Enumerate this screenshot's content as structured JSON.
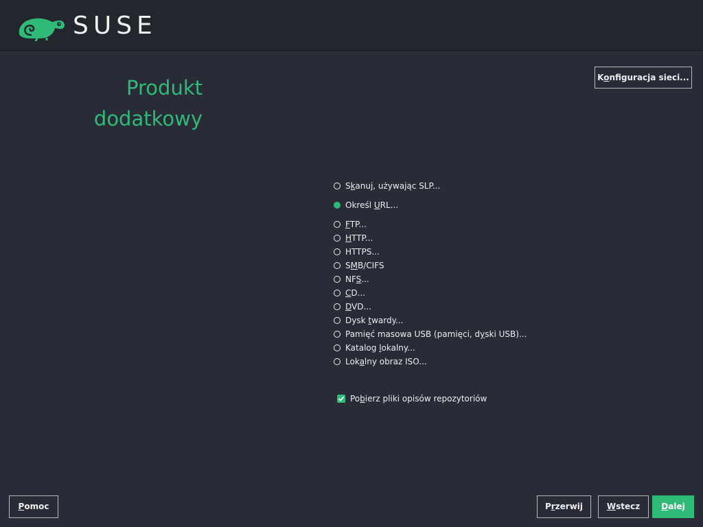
{
  "header": {
    "brand": "SUSE",
    "logo_icon": "suse-chameleon-logo"
  },
  "title": {
    "line1": "Produkt",
    "line2": "dodatkowy"
  },
  "network_button": {
    "pre": "K",
    "ul": "o",
    "post": "nfiguracja sieci..."
  },
  "radio_options": [
    {
      "pre": "S",
      "ul": "k",
      "post": "anuj, używając SLP...",
      "selected": false
    },
    {
      "pre": "Określ ",
      "ul": "U",
      "post": "RL...",
      "selected": true
    },
    {
      "pre": "",
      "ul": "F",
      "post": "TP...",
      "selected": false
    },
    {
      "pre": "",
      "ul": "H",
      "post": "TTP...",
      "selected": false
    },
    {
      "pre": "HTTPS...",
      "ul": "",
      "post": "",
      "selected": false
    },
    {
      "pre": "S",
      "ul": "M",
      "post": "B/CIFS",
      "selected": false
    },
    {
      "pre": "NF",
      "ul": "S",
      "post": "...",
      "selected": false
    },
    {
      "pre": "",
      "ul": "C",
      "post": "D...",
      "selected": false
    },
    {
      "pre": "",
      "ul": "D",
      "post": "VD...",
      "selected": false
    },
    {
      "pre": "Dysk ",
      "ul": "t",
      "post": "wardy...",
      "selected": false
    },
    {
      "pre": "Pamięć masowa USB (pamięci, d",
      "ul": "y",
      "post": "ski USB)...",
      "selected": false
    },
    {
      "pre": "Katalog ",
      "ul": "l",
      "post": "okalny...",
      "selected": false
    },
    {
      "pre": "Lok",
      "ul": "a",
      "post": "lny obraz ISO...",
      "selected": false
    }
  ],
  "checkbox": {
    "pre": "Po",
    "ul": "b",
    "post": "ierz pliki opisów repozytoriów",
    "checked": true
  },
  "footer": {
    "help": {
      "pre": "",
      "ul": "P",
      "post": "omoc"
    },
    "abort": {
      "pre": "P",
      "ul": "r",
      "post": "zerwij"
    },
    "back": {
      "pre": "",
      "ul": "W",
      "post": "stecz"
    },
    "next": {
      "pre": "",
      "ul": "D",
      "post": "alej"
    }
  },
  "colors": {
    "accent": "#30ba78",
    "background": "#292b37",
    "header": "#24262e"
  }
}
